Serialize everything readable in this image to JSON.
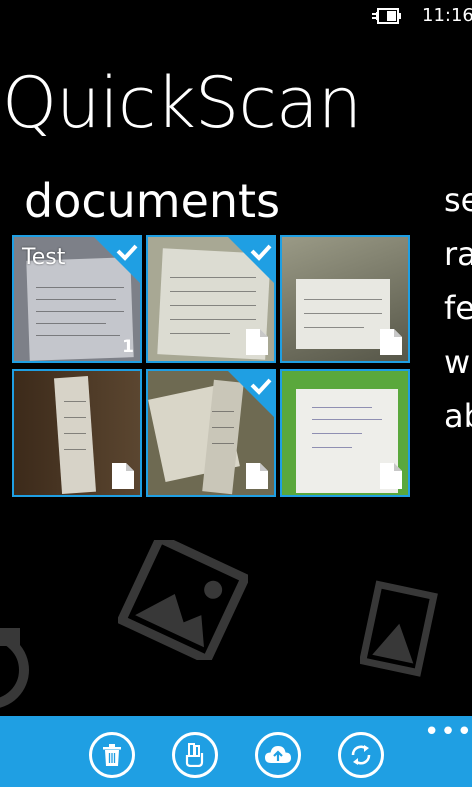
{
  "status_bar": {
    "time": "11:16",
    "battery_icon": "battery-charging-icon"
  },
  "app": {
    "title": "QuickScan"
  },
  "pivot": {
    "header": "documents",
    "next_items": [
      "se",
      "ra",
      "fe",
      "w",
      "ab"
    ]
  },
  "documents": [
    {
      "label": "Test",
      "count": "1",
      "selected": true
    },
    {
      "label": "",
      "count": "",
      "selected": true
    },
    {
      "label": "",
      "count": "",
      "selected": false
    },
    {
      "label": "",
      "count": "",
      "selected": false
    },
    {
      "label": "",
      "count": "",
      "selected": true
    },
    {
      "label": "",
      "count": "",
      "selected": false
    }
  ],
  "app_bar": {
    "buttons": [
      "trash-icon",
      "share-hand-icon",
      "upload-cloud-icon",
      "sync-icon"
    ],
    "more": "•••"
  },
  "colors": {
    "accent": "#1f9fe3",
    "background": "#000000"
  }
}
